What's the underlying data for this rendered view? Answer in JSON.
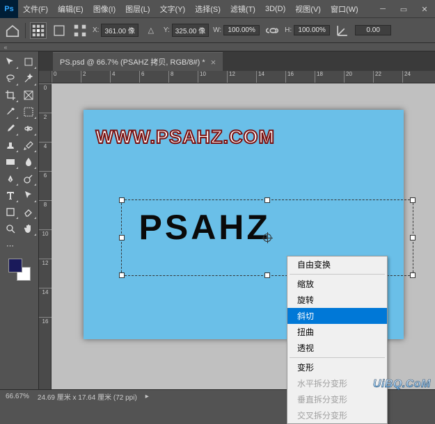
{
  "logo": "Ps",
  "menu": [
    "文件(F)",
    "编辑(E)",
    "图像(I)",
    "图层(L)",
    "文字(Y)",
    "选择(S)",
    "滤镜(T)",
    "3D(D)",
    "视图(V)",
    "窗口(W)"
  ],
  "options": {
    "x_label": "X:",
    "x_value": "361.00 像",
    "y_label": "Y:",
    "y_value": "325.00 像",
    "w_label": "W:",
    "w_value": "100.00%",
    "h_label": "H:",
    "h_value": "100.00%",
    "angle_value": "0.00"
  },
  "document_tab": "PS.psd @ 66.7% (PSAHZ 拷贝, RGB/8#) *",
  "ruler_h": [
    "0",
    "2",
    "4",
    "6",
    "8",
    "10",
    "12",
    "14",
    "16",
    "18",
    "20",
    "22",
    "24"
  ],
  "ruler_v": [
    "0",
    "2",
    "4",
    "6",
    "8",
    "10",
    "12",
    "14",
    "16"
  ],
  "canvas": {
    "url_text": "WWW.PSAHZ.COM",
    "main_text": "PSAHZ"
  },
  "context_menu": {
    "items": [
      {
        "label": "自由变换",
        "type": "item"
      },
      {
        "type": "sep"
      },
      {
        "label": "缩放",
        "type": "item"
      },
      {
        "label": "旋转",
        "type": "item"
      },
      {
        "label": "斜切",
        "type": "item",
        "highlighted": true
      },
      {
        "label": "扭曲",
        "type": "item"
      },
      {
        "label": "透视",
        "type": "item"
      },
      {
        "type": "sep"
      },
      {
        "label": "变形",
        "type": "item"
      },
      {
        "label": "水平拆分变形",
        "type": "disabled"
      },
      {
        "label": "垂直拆分变形",
        "type": "disabled"
      },
      {
        "label": "交叉拆分变形",
        "type": "disabled"
      }
    ]
  },
  "statusbar": {
    "zoom": "66.67%",
    "doc_info": "24.69 厘米 x 17.64 厘米 (72 ppi)"
  },
  "watermark": "UiBQ.CoM",
  "colors": {
    "foreground": "#1a1a5a",
    "background": "#ffffff"
  }
}
